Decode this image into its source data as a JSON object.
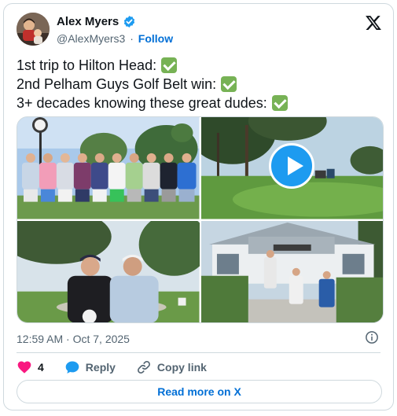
{
  "author": {
    "name": "Alex Myers",
    "handle": "@AlexMyers3",
    "separator": "·",
    "follow_label": "Follow"
  },
  "tweet": {
    "lines": [
      "1st trip to Hilton Head:",
      "2nd Pelham Guys Golf Belt win:",
      "3+ decades knowing these great dudes:"
    ]
  },
  "media": {
    "tiles": [
      "group-photo",
      "video-golf-course",
      "two-golfers-photo",
      "clubhouse-photo"
    ]
  },
  "meta": {
    "timestamp": "12:59 AM · Oct 7, 2025"
  },
  "actions": {
    "like_count": "4",
    "reply_label": "Reply",
    "copy_link_label": "Copy link"
  },
  "footer": {
    "read_more_label": "Read more on X"
  },
  "colors": {
    "accent": "#1d9bf0",
    "link": "#006fd6",
    "like": "#f91880",
    "check": "#77b255"
  }
}
